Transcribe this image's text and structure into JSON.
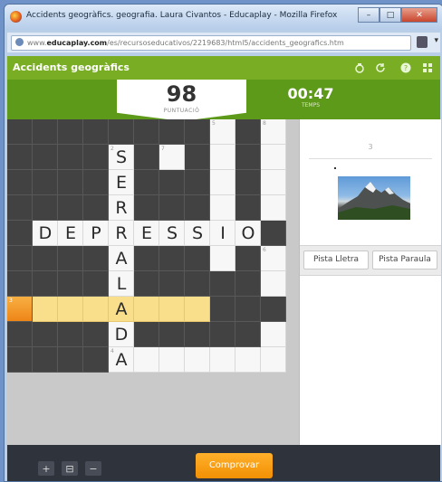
{
  "window": {
    "title": "Accidents geogràfics. geografia. Laura Civantos - Educaplay - Mozilla Firefox",
    "controls": [
      "–",
      "□",
      "✕"
    ]
  },
  "browser": {
    "url_prefix": "www.",
    "url_domain": "educaplay.com",
    "url_path": "/es/recursoseducativos/2219683/html5/accidents_geografics.htm"
  },
  "app": {
    "title": "Accidents geogràfics",
    "toolbar_icons": [
      "fullscreen-icon",
      "restart-icon",
      "help-icon",
      "grid-icon"
    ]
  },
  "hud": {
    "score_value": "98",
    "score_label": "PUNTUACIÓ",
    "time_value": "00:47",
    "time_label": "TEMPS"
  },
  "crossword": {
    "rows": 10,
    "cols": 11,
    "white_cells": [
      [
        0,
        8
      ],
      [
        0,
        10
      ],
      [
        1,
        4
      ],
      [
        1,
        6
      ],
      [
        1,
        8
      ],
      [
        1,
        10
      ],
      [
        2,
        4
      ],
      [
        2,
        8
      ],
      [
        2,
        10
      ],
      [
        3,
        4
      ],
      [
        3,
        8
      ],
      [
        3,
        10
      ],
      [
        4,
        1
      ],
      [
        4,
        2
      ],
      [
        4,
        3
      ],
      [
        4,
        4
      ],
      [
        4,
        5
      ],
      [
        4,
        6
      ],
      [
        4,
        7
      ],
      [
        4,
        8
      ],
      [
        4,
        9
      ],
      [
        5,
        4
      ],
      [
        5,
        8
      ],
      [
        5,
        10
      ],
      [
        6,
        4
      ],
      [
        6,
        10
      ],
      [
        8,
        4
      ],
      [
        8,
        10
      ],
      [
        9,
        4
      ],
      [
        9,
        5
      ],
      [
        9,
        6
      ],
      [
        9,
        7
      ],
      [
        9,
        8
      ],
      [
        9,
        9
      ],
      [
        9,
        10
      ]
    ],
    "highlight_cells": [
      [
        7,
        1
      ],
      [
        7,
        2
      ],
      [
        7,
        3
      ],
      [
        7,
        4
      ],
      [
        7,
        5
      ],
      [
        7,
        6
      ],
      [
        7,
        7
      ]
    ],
    "current_cell": [
      7,
      0
    ],
    "numbers": [
      {
        "r": 0,
        "c": 8,
        "n": "5"
      },
      {
        "r": 0,
        "c": 10,
        "n": "8"
      },
      {
        "r": 1,
        "c": 4,
        "n": "2"
      },
      {
        "r": 1,
        "c": 6,
        "n": "7"
      },
      {
        "r": 5,
        "c": 10,
        "n": "6"
      },
      {
        "r": 7,
        "c": 0,
        "n": "3"
      },
      {
        "r": 9,
        "c": 4,
        "n": "4"
      }
    ],
    "letters": [
      {
        "r": 1,
        "c": 4,
        "ch": "S"
      },
      {
        "r": 2,
        "c": 4,
        "ch": "E"
      },
      {
        "r": 3,
        "c": 4,
        "ch": "R"
      },
      {
        "r": 4,
        "c": 1,
        "ch": "D"
      },
      {
        "r": 4,
        "c": 2,
        "ch": "E"
      },
      {
        "r": 4,
        "c": 3,
        "ch": "P"
      },
      {
        "r": 4,
        "c": 4,
        "ch": "R"
      },
      {
        "r": 4,
        "c": 5,
        "ch": "E"
      },
      {
        "r": 4,
        "c": 6,
        "ch": "S"
      },
      {
        "r": 4,
        "c": 7,
        "ch": "S"
      },
      {
        "r": 4,
        "c": 8,
        "ch": "I"
      },
      {
        "r": 4,
        "c": 9,
        "ch": "O"
      },
      {
        "r": 5,
        "c": 4,
        "ch": "A"
      },
      {
        "r": 6,
        "c": 4,
        "ch": "L"
      },
      {
        "r": 7,
        "c": 4,
        "ch": "A"
      },
      {
        "r": 8,
        "c": 4,
        "ch": "D"
      },
      {
        "r": 9,
        "c": 4,
        "ch": "A"
      }
    ]
  },
  "clue": {
    "number": "3",
    "image_icon": "mountain-photo"
  },
  "hints": {
    "letter_label": "Pista Lletra",
    "word_label": "Pista Paraula"
  },
  "footer": {
    "zoom_in": "+",
    "zoom_reset": "⊟",
    "zoom_out": "−",
    "check_label": "Comprovar"
  },
  "colors": {
    "app_green": "#79ad24",
    "hud_green": "#5e9a1a",
    "highlight": "#f9de8c",
    "current": "#f29004",
    "check_button": "#f29004"
  }
}
